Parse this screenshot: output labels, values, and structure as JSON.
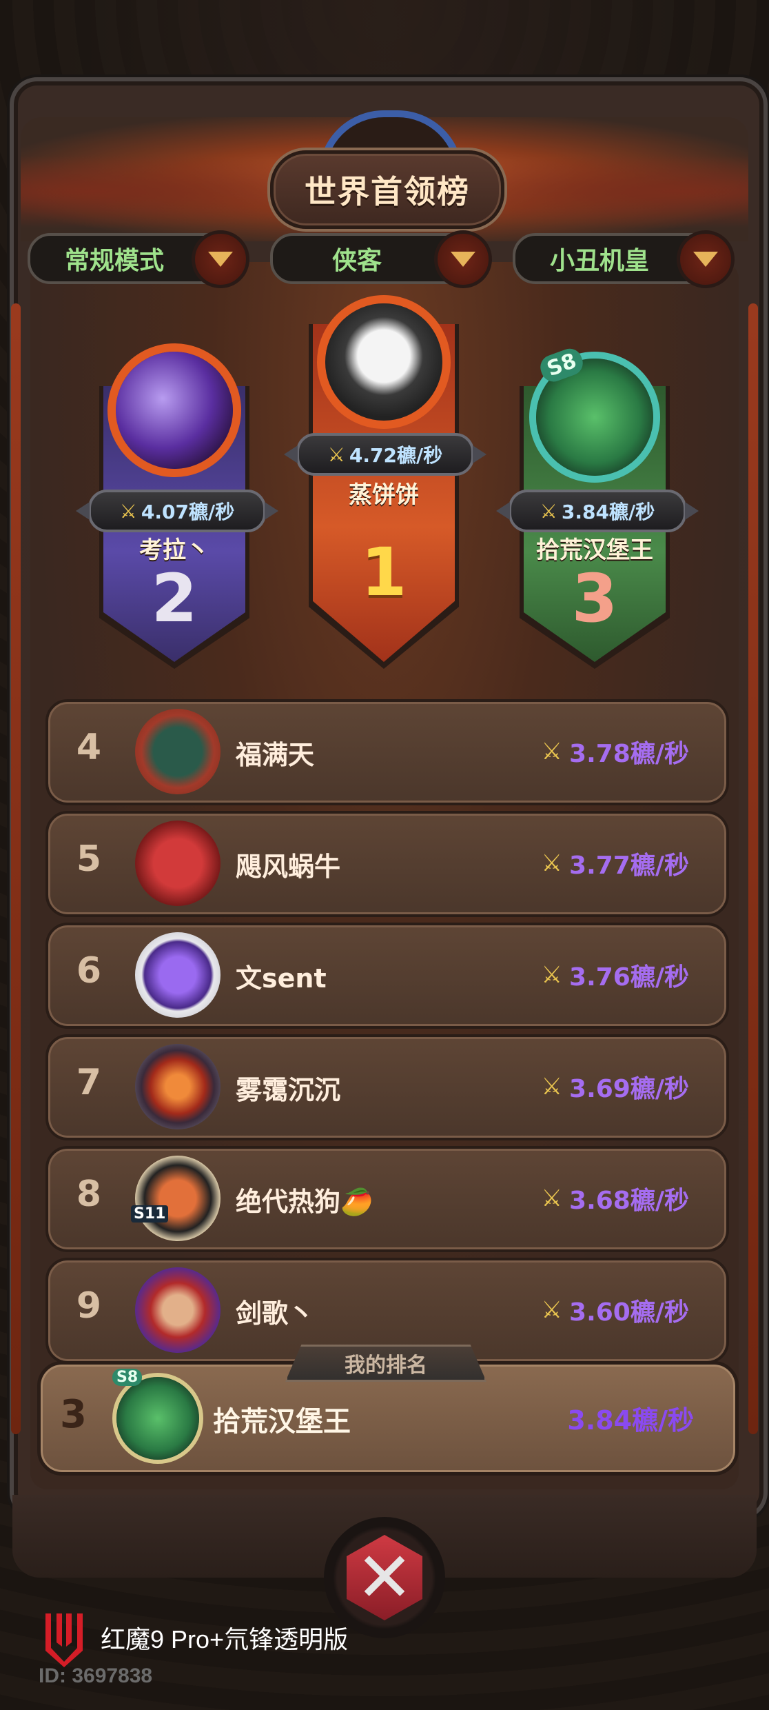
{
  "title": "世界首领榜",
  "filters": [
    {
      "label": "常规模式"
    },
    {
      "label": "侠客"
    },
    {
      "label": "小丑机皇"
    }
  ],
  "podium": [
    {
      "rank": "1",
      "name": "蒸饼饼",
      "score": "4.72穮/秒"
    },
    {
      "rank": "2",
      "name": "考拉丶",
      "score": "4.07穮/秒"
    },
    {
      "rank": "3",
      "name": "拾荒汉堡王",
      "score": "3.84穮/秒",
      "badge": "S8"
    }
  ],
  "rows": [
    {
      "rank": "4",
      "name": "福满天",
      "score": "3.78穮/秒"
    },
    {
      "rank": "5",
      "name": "飓风蜗牛",
      "score": "3.77穮/秒"
    },
    {
      "rank": "6",
      "name": "文sent",
      "score": "3.76穮/秒"
    },
    {
      "rank": "7",
      "name": "雾霭沉沉",
      "score": "3.69穮/秒"
    },
    {
      "rank": "8",
      "name": "绝代热狗🥭",
      "score": "3.68穮/秒",
      "badge": "S11"
    },
    {
      "rank": "9",
      "name": "剑歌丶",
      "score": "3.60穮/秒"
    }
  ],
  "my_rank": {
    "label": "我的排名",
    "rank": "3",
    "name": "拾荒汉堡王",
    "score": "3.84穮/秒",
    "badge": "S8"
  },
  "watermark": {
    "device": "红魔9 Pro+氘锋透明版",
    "id": "ID: 3697838"
  },
  "icons": {
    "sword": "crossed-swords-icon",
    "dropdown": "chevron-down-icon",
    "close": "close-icon"
  },
  "colors": {
    "gold": "#e9c44f",
    "purple": "#a56df0",
    "green": "#9fe28c",
    "rank1": "#c4451d",
    "rank2": "#4a3a8a",
    "rank3": "#3f6a3a"
  }
}
